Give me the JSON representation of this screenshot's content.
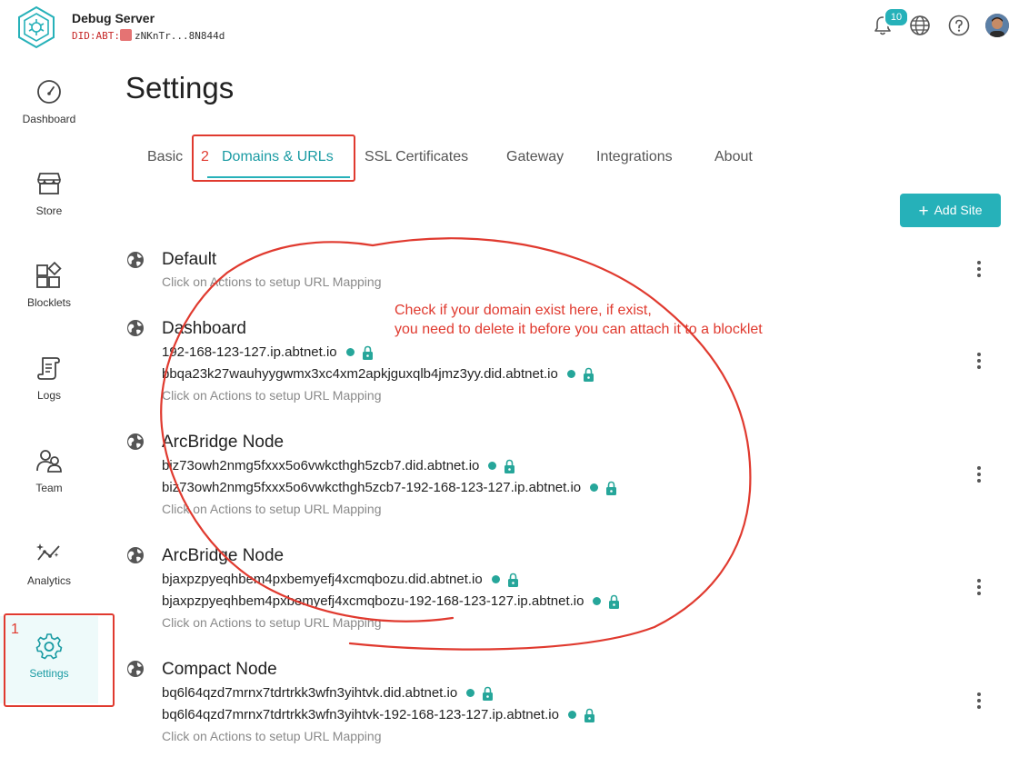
{
  "header": {
    "app_title": "Debug Server",
    "did_prefix": "DID:ABT:",
    "did_value": "zNKnTr...8N844d",
    "notification_count": "10"
  },
  "sidebar": {
    "items": [
      {
        "label": "Dashboard",
        "icon": "gauge-icon"
      },
      {
        "label": "Store",
        "icon": "store-icon"
      },
      {
        "label": "Blocklets",
        "icon": "blocks-icon"
      },
      {
        "label": "Logs",
        "icon": "scroll-icon"
      },
      {
        "label": "Team",
        "icon": "team-icon"
      },
      {
        "label": "Analytics",
        "icon": "analytics-icon"
      },
      {
        "label": "Settings",
        "icon": "gear-icon",
        "active": true
      }
    ]
  },
  "main": {
    "title": "Settings",
    "tabs": [
      {
        "label": "Basic"
      },
      {
        "label": "Domains & URLs",
        "active": true
      },
      {
        "label": "SSL Certificates"
      },
      {
        "label": "Gateway"
      },
      {
        "label": "Integrations"
      },
      {
        "label": "About"
      }
    ],
    "add_site_label": "Add Site",
    "sites": [
      {
        "name": "Default",
        "urls": [],
        "hint": "Click on Actions to setup URL Mapping"
      },
      {
        "name": "Dashboard",
        "urls": [
          "192-168-123-127.ip.abtnet.io",
          "bbqa23k27wauhyygwmx3xc4xm2apkjguxqlb4jmz3yy.did.abtnet.io"
        ],
        "hint": "Click on Actions to setup URL Mapping"
      },
      {
        "name": "ArcBridge Node",
        "urls": [
          "biz73owh2nmg5fxxx5o6vwkcthgh5zcb7.did.abtnet.io",
          "biz73owh2nmg5fxxx5o6vwkcthgh5zcb7-192-168-123-127.ip.abtnet.io"
        ],
        "hint": "Click on Actions to setup URL Mapping"
      },
      {
        "name": "ArcBridge Node",
        "urls": [
          "bjaxpzpyeqhbem4pxbemyefj4xcmqbozu.did.abtnet.io",
          "bjaxpzpyeqhbem4pxbemyefj4xcmqbozu-192-168-123-127.ip.abtnet.io"
        ],
        "hint": "Click on Actions to setup URL Mapping"
      },
      {
        "name": "Compact Node",
        "urls": [
          "bq6l64qzd7mrnx7tdrtrkk3wfn3yihtvk.did.abtnet.io",
          "bq6l64qzd7mrnx7tdrtrkk3wfn3yihtvk-192-168-123-127.ip.abtnet.io"
        ],
        "hint": "Click on Actions to setup URL Mapping"
      }
    ]
  },
  "annotations": {
    "step1": "1",
    "step2": "2",
    "note_line1": "Check if your domain exist here, if exist,",
    "note_line2": "you need to delete it before you can attach it to a blocklet"
  },
  "colors": {
    "accent": "#26b1b9",
    "status_dot": "#26a69a",
    "annotation": "#e03a2f"
  }
}
